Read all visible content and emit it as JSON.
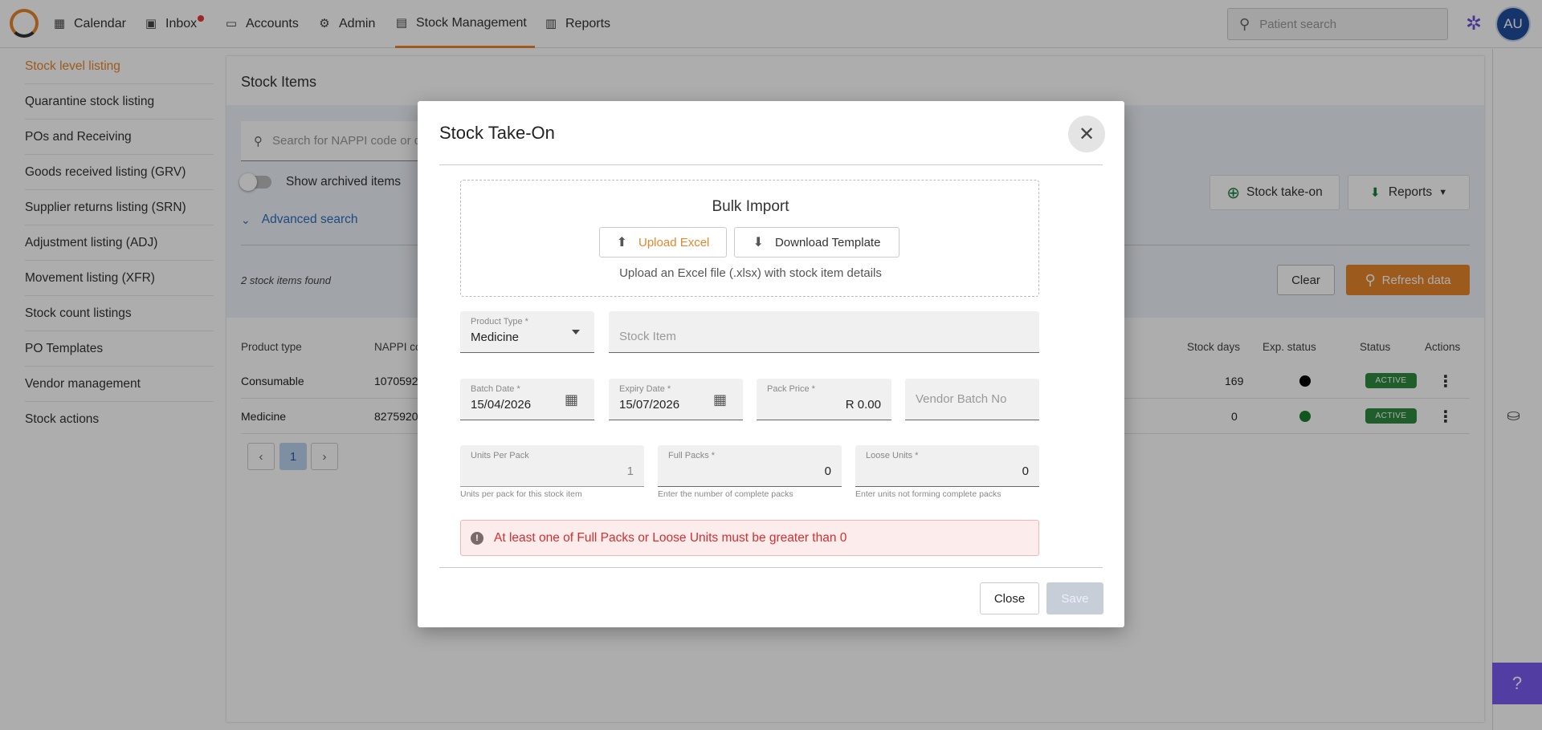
{
  "nav": {
    "items": [
      {
        "label": "Calendar",
        "icon": "calendar-icon"
      },
      {
        "label": "Inbox",
        "icon": "inbox-icon"
      },
      {
        "label": "Accounts",
        "icon": "folder-icon"
      },
      {
        "label": "Admin",
        "icon": "admin-icon"
      },
      {
        "label": "Stock Management",
        "icon": "stock-icon"
      },
      {
        "label": "Reports",
        "icon": "reports-icon"
      }
    ],
    "active": "Stock Management",
    "search_placeholder": "Patient search",
    "avatar_initials": "AU",
    "accent_color": "#e8852c"
  },
  "sidebar": {
    "items": [
      {
        "label": "Stock level listing"
      },
      {
        "label": "Quarantine stock listing"
      },
      {
        "label": "POs and Receiving"
      },
      {
        "label": "Goods received listing (GRV)"
      },
      {
        "label": "Supplier returns listing (SRN)"
      },
      {
        "label": "Adjustment listing (ADJ)"
      },
      {
        "label": "Movement listing (XFR)"
      },
      {
        "label": "Stock count listings"
      },
      {
        "label": "PO Templates"
      },
      {
        "label": "Vendor management"
      },
      {
        "label": "Stock actions"
      }
    ],
    "active": "Stock level listing"
  },
  "main": {
    "title": "Stock Items",
    "search_placeholder": "Search for NAPPI code or d",
    "show_archived_label": "Show archived items",
    "advanced_search_label": "Advanced search",
    "found_text": "2 stock items found",
    "stock_takeon_label": "Stock take-on",
    "reports_label": "Reports",
    "clear_label": "Clear",
    "refresh_label": "Refresh data",
    "columns": {
      "product_type": "Product type",
      "nappi": "NAPPI co",
      "stock_days": "Stock days",
      "exp_status": "Exp. status",
      "status": "Status",
      "actions": "Actions"
    },
    "rows": [
      {
        "product_type": "Consumable",
        "nappi": "10705920",
        "stock_days": "169",
        "exp_color": "#000000",
        "status": "ACTIVE"
      },
      {
        "product_type": "Medicine",
        "nappi": "8275920",
        "stock_days": "0",
        "exp_color": "#1a7f2a",
        "status": "ACTIVE"
      }
    ],
    "current_page": "1"
  },
  "modal": {
    "title": "Stock Take-On",
    "bulk": {
      "title": "Bulk Import",
      "upload_label": "Upload Excel",
      "download_label": "Download Template",
      "hint": "Upload an Excel file (.xlsx) with stock item details"
    },
    "product_type": {
      "label": "Product Type *",
      "value": "Medicine"
    },
    "stock_item": {
      "placeholder": "Stock Item"
    },
    "batch_date": {
      "label": "Batch Date *",
      "value": "15/04/2026"
    },
    "expiry_date": {
      "label": "Expiry Date *",
      "value": "15/07/2026"
    },
    "pack_price": {
      "label": "Pack Price *",
      "value": "R 0.00"
    },
    "vendor_batch": {
      "placeholder": "Vendor Batch No"
    },
    "units_per_pack": {
      "label": "Units Per Pack",
      "value": "1",
      "helper": "Units per pack for this stock item"
    },
    "full_packs": {
      "label": "Full Packs *",
      "value": "0",
      "helper": "Enter the number of complete packs"
    },
    "loose_units": {
      "label": "Loose Units *",
      "value": "0",
      "helper": "Enter units not forming complete packs"
    },
    "error": "At least one of Full Packs or Loose Units must be greater than 0",
    "close_label": "Close",
    "save_label": "Save"
  }
}
